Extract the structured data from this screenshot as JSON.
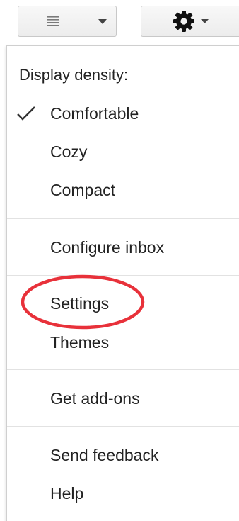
{
  "toolbar": {
    "density_button_icon": "list-lines-icon",
    "density_dropdown_icon": "caret-down-icon",
    "settings_button_icon": "gear-icon",
    "settings_dropdown_icon": "caret-down-icon"
  },
  "menu": {
    "heading": "Display density:",
    "density_options": [
      {
        "label": "Comfortable",
        "selected": true
      },
      {
        "label": "Cozy",
        "selected": false
      },
      {
        "label": "Compact",
        "selected": false
      }
    ],
    "configure_inbox": "Configure inbox",
    "settings": "Settings",
    "themes": "Themes",
    "get_addons": "Get add-ons",
    "send_feedback": "Send feedback",
    "help": "Help"
  },
  "annotation": {
    "highlight_color": "#e8313a",
    "highlighted_item": "Settings"
  },
  "colors": {
    "text": "#222222",
    "button_border": "#c8c8c8",
    "divider": "#e2e2e2"
  }
}
